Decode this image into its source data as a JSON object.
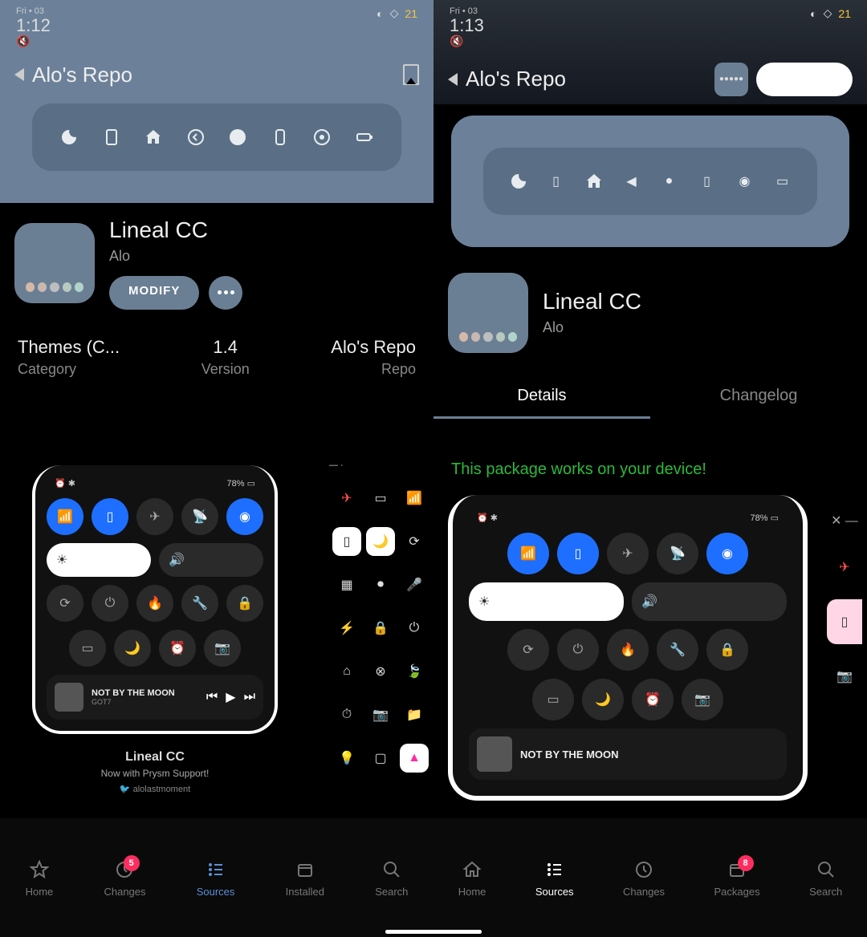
{
  "status": {
    "day": "Fri • 03",
    "time_a": "1:12",
    "time_b": "1:13",
    "battery_pct": "21"
  },
  "header": {
    "title": "Alo's Repo"
  },
  "package": {
    "name": "Lineal CC",
    "author": "Alo",
    "modify": "MODIFY"
  },
  "meta": {
    "cat_val": "Themes (C...",
    "cat_lbl": "Category",
    "ver_val": "1.4",
    "ver_lbl": "Version",
    "repo_val": "Alo's Repo",
    "repo_lbl": "Repo"
  },
  "tabs": {
    "details": "Details",
    "changelog": "Changelog"
  },
  "compat": "This package works on your device!",
  "shot": {
    "battery": "78%",
    "np_title": "NOT BY THE MOON",
    "np_artist": "GOT7"
  },
  "promo": {
    "t1": "Lineal CC",
    "t2": "Now with Prysm Support!",
    "t3": "alolastmoment"
  },
  "nav_a": {
    "home": "Home",
    "changes": "Changes",
    "changes_badge": "5",
    "sources": "Sources",
    "installed": "Installed",
    "search": "Search"
  },
  "nav_b": {
    "home": "Home",
    "sources": "Sources",
    "changes": "Changes",
    "packages": "Packages",
    "packages_badge": "8",
    "search": "Search"
  },
  "icon_colors": [
    "#d4b8a8",
    "#c9b8b0",
    "#bcbec0",
    "#b8c9c0",
    "#b0d4ca"
  ]
}
